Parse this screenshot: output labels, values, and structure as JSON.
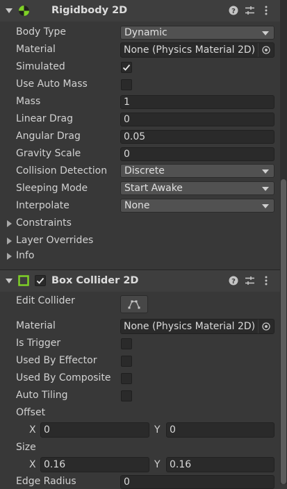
{
  "rigidbody": {
    "title": "Rigidbody 2D",
    "body_type": {
      "label": "Body Type",
      "value": "Dynamic"
    },
    "material": {
      "label": "Material",
      "value": "None (Physics Material 2D)"
    },
    "simulated": {
      "label": "Simulated",
      "checked": true
    },
    "use_auto_mass": {
      "label": "Use Auto Mass",
      "checked": false
    },
    "mass": {
      "label": "Mass",
      "value": "1"
    },
    "linear_drag": {
      "label": "Linear Drag",
      "value": "0"
    },
    "angular_drag": {
      "label": "Angular Drag",
      "value": "0.05"
    },
    "gravity_scale": {
      "label": "Gravity Scale",
      "value": "0"
    },
    "collision_detection": {
      "label": "Collision Detection",
      "value": "Discrete"
    },
    "sleeping_mode": {
      "label": "Sleeping Mode",
      "value": "Start Awake"
    },
    "interpolate": {
      "label": "Interpolate",
      "value": "None"
    },
    "constraints": "Constraints",
    "layer_overrides": "Layer Overrides",
    "info": "Info"
  },
  "box_collider": {
    "title": "Box Collider 2D",
    "enabled": true,
    "edit_collider": {
      "label": "Edit Collider"
    },
    "material": {
      "label": "Material",
      "value": "None (Physics Material 2D)"
    },
    "is_trigger": {
      "label": "Is Trigger",
      "checked": false
    },
    "used_by_effector": {
      "label": "Used By Effector",
      "checked": false
    },
    "used_by_composite": {
      "label": "Used By Composite",
      "checked": false
    },
    "auto_tiling": {
      "label": "Auto Tiling",
      "checked": false
    },
    "offset": {
      "label": "Offset",
      "x_label": "X",
      "x": "0",
      "y_label": "Y",
      "y": "0"
    },
    "size": {
      "label": "Size",
      "x_label": "X",
      "x": "0.16",
      "y_label": "Y",
      "y": "0.16"
    },
    "edge_radius": {
      "label": "Edge Radius",
      "value": "0"
    }
  },
  "colors": {
    "background": "#383838",
    "header": "#3e3e3e",
    "accent_green": "#7fd126"
  },
  "icons": [
    "rigidbody2d-icon",
    "help-icon",
    "presets-icon",
    "kebab-menu-icon",
    "box-collider2d-icon",
    "edit-collider-icon",
    "object-picker-icon",
    "checkmark-icon"
  ]
}
